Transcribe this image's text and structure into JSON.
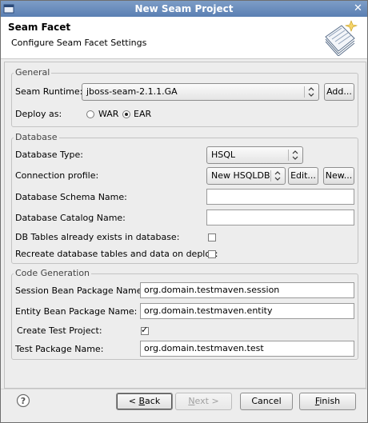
{
  "window": {
    "title": "New Seam Project",
    "close_glyph": "✕"
  },
  "header": {
    "title": "Seam Facet",
    "description": "Configure Seam Facet Settings",
    "icon": "seam-facet-wizard-icon"
  },
  "general": {
    "legend": "General",
    "runtime_label": "Seam Runtime:",
    "runtime_value": "jboss-seam-2.1.1.GA",
    "add_button": "Add...",
    "deploy_label": "Deploy as:",
    "deploy_options": [
      {
        "label": "WAR",
        "selected": false
      },
      {
        "label": "EAR",
        "selected": true
      }
    ]
  },
  "database": {
    "legend": "Database",
    "type_label": "Database Type:",
    "type_value": "HSQL",
    "profile_label": "Connection profile:",
    "profile_value": "New HSQLDB",
    "edit_button": "Edit...",
    "new_button": "New...",
    "schema_label": "Database Schema Name:",
    "schema_value": "",
    "catalog_label": "Database Catalog Name:",
    "catalog_value": "",
    "tables_exist_label": "DB Tables already exists in database:",
    "tables_exist_checked": false,
    "recreate_label": "Recreate database tables and data on deploy:",
    "recreate_checked": false
  },
  "codegen": {
    "legend": "Code Generation",
    "session_label": "Session Bean Package Name:",
    "session_value": "org.domain.testmaven.session",
    "entity_label": "Entity Bean Package Name:",
    "entity_value": "org.domain.testmaven.entity",
    "create_test_label": "Create Test Project:",
    "create_test_checked": true,
    "test_pkg_label": "Test Package Name:",
    "test_pkg_value": "org.domain.testmaven.test"
  },
  "footer": {
    "help_icon": "help-icon",
    "back_prefix": "< ",
    "back_mnemonic": "B",
    "back_rest": "ack",
    "next_mnemonic": "N",
    "next_rest": "ext >",
    "cancel": "Cancel",
    "finish_mnemonic": "F",
    "finish_rest": "inish"
  }
}
